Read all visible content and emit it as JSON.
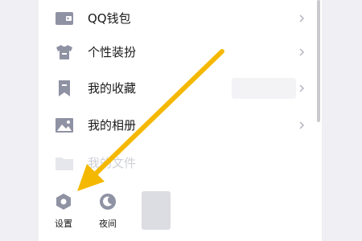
{
  "menu": {
    "items": [
      {
        "label": "QQ钱包",
        "icon": "wallet-icon"
      },
      {
        "label": "个性装扮",
        "icon": "tshirt-icon"
      },
      {
        "label": "我的收藏",
        "icon": "bookmark-icon"
      },
      {
        "label": "我的相册",
        "icon": "photo-icon"
      },
      {
        "label": "我的文件",
        "icon": "folder-icon"
      }
    ]
  },
  "bottom_bar": {
    "settings_label": "设置",
    "night_label": "夜间"
  },
  "colors": {
    "accent_arrow": "#f5b800",
    "icon_gray": "#8f92a3",
    "text": "#1a1a1a"
  }
}
